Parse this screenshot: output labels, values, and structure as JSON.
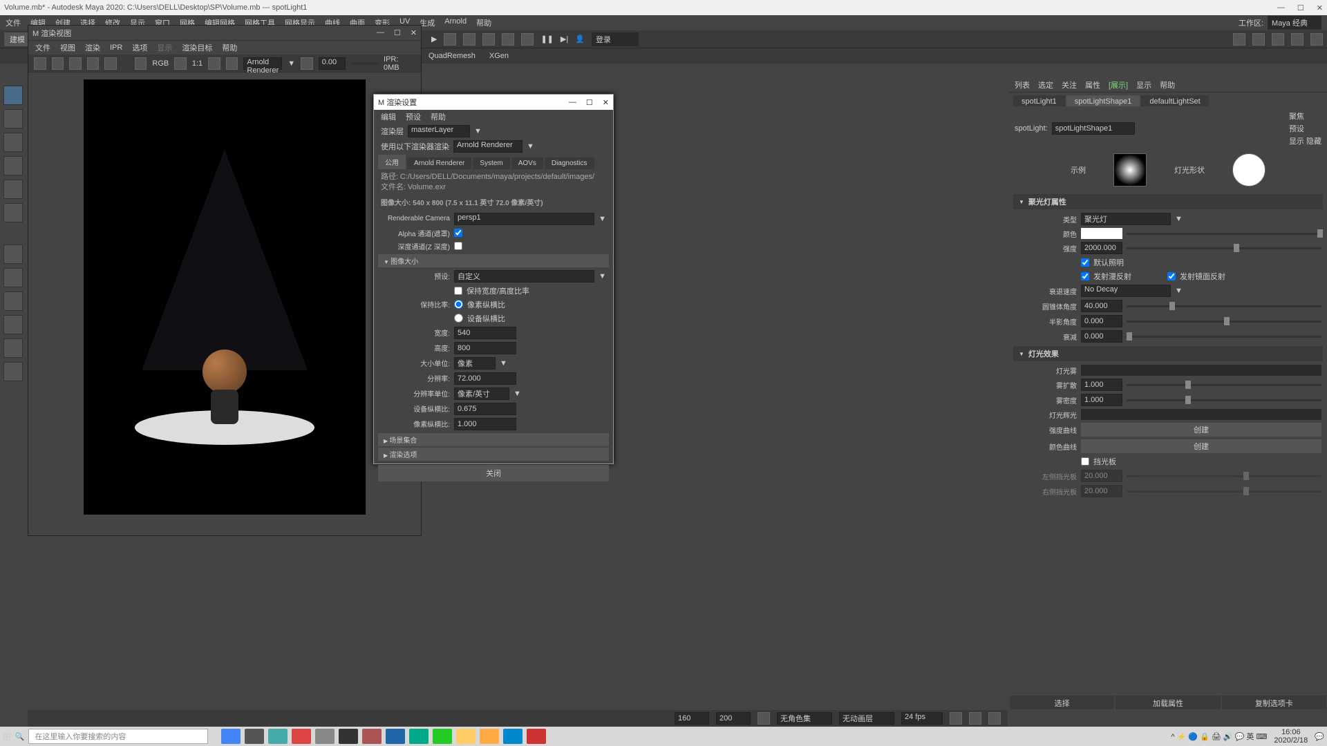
{
  "titlebar": "Volume.mb* - Autodesk Maya 2020: C:\\Users\\DELL\\Desktop\\SP\\Volume.mb  ---  spotLight1",
  "menus": [
    "文件",
    "编辑",
    "创建",
    "选择",
    "修改",
    "显示",
    "窗口",
    "网格",
    "编辑网格",
    "网格工具",
    "网格显示",
    "曲线",
    "曲面",
    "变形",
    "UV",
    "生成",
    "Arnold",
    "帮助"
  ],
  "workspace_label": "工作区:",
  "workspace_value": "Maya 经典",
  "shelf": {
    "mode": "建模",
    "login": "登录"
  },
  "tabs": [
    "QuadRemesh",
    "XGen"
  ],
  "rv": {
    "title": "渲染视图",
    "menus": [
      "文件",
      "视图",
      "渲染",
      "IPR",
      "选项",
      "显示",
      "渲染目标",
      "帮助"
    ],
    "renderer": "Arnold Renderer",
    "rgb": "RGB",
    "ratio": "1:1",
    "exposure": "0.00",
    "ipr": "IPR: 0MB"
  },
  "dlg": {
    "title": "渲染设置",
    "menus": [
      "编辑",
      "预设",
      "帮助"
    ],
    "layer_label": "渲染层",
    "layer_value": "masterLayer",
    "renderer_label": "使用以下渲染器渲染",
    "renderer_value": "Arnold Renderer",
    "tabs": [
      "公用",
      "Arnold Renderer",
      "System",
      "AOVs",
      "Diagnostics"
    ],
    "path_label": "路径:",
    "path_value": "C:/Users/DELL/Documents/maya/projects/default/images/",
    "file_label": "文件名:",
    "file_value": "Volume.exr",
    "size_info": "图像大小: 540 x 800 (7.5 x 11.1 英寸 72.0 像素/英寸)",
    "cam_label": "Renderable Camera",
    "cam_value": "persp1",
    "alpha_label": "Alpha 通道(遮罩)",
    "depth_label": "深度通道(Z 深度)",
    "section_imgsize": "图像大小",
    "preset_label": "预设:",
    "preset_value": "自定义",
    "keep_ratio": "保持宽度/高度比率",
    "keep_ratio2_label": "保持比率:",
    "keep_ratio2_opt1": "像素纵横比",
    "keep_ratio2_opt2": "设备纵横比",
    "width_label": "宽度:",
    "width_value": "540",
    "height_label": "高度:",
    "height_value": "800",
    "unit_label": "大小单位:",
    "unit_value": "像素",
    "res_label": "分辨率:",
    "res_value": "72.000",
    "resunit_label": "分辨率单位:",
    "resunit_value": "像素/英寸",
    "dev_label": "设备纵横比:",
    "dev_value": "0.675",
    "pix_label": "像素纵横比:",
    "pix_value": "1.000",
    "section_scene": "场景集合",
    "section_opts": "渲染选项",
    "close": "关闭"
  },
  "attr": {
    "tabs": [
      "列表",
      "选定",
      "关注",
      "属性",
      "展示",
      "显示",
      "帮助"
    ],
    "subtabs": [
      "spotLight1",
      "spotLightShape1",
      "defaultLightSet"
    ],
    "node_label": "spotLight:",
    "node_value": "spotLightShape1",
    "focus": "聚焦",
    "preset": "预设",
    "show": "显示",
    "hide": "隐藏",
    "sample_label": "示例",
    "light_shape_label": "灯光形状",
    "section_spot": "聚光灯属性",
    "type_label": "类型",
    "type_value": "聚光灯",
    "color_label": "颜色",
    "intensity_label": "强度",
    "intensity_value": "2000.000",
    "illum_default": "默认照明",
    "emit_diffuse": "发射漫反射",
    "emit_specular": "发射镜面反射",
    "decay_label": "衰退速度",
    "decay_value": "No Decay",
    "cone_label": "圆锥体角度",
    "cone_value": "40.000",
    "penumbra_label": "半影角度",
    "penumbra_value": "0.000",
    "dropoff_label": "衰减",
    "dropoff_value": "0.000",
    "section_fx": "灯光效果",
    "light_fog": "灯光雾",
    "fog_spread_label": "雾扩散",
    "fog_spread_value": "1.000",
    "fog_density_label": "雾密度",
    "fog_density_value": "1.000",
    "light_glow": "灯光辉光",
    "intensity_curve_label": "强度曲线",
    "create": "创建",
    "color_curve_label": "颜色曲线",
    "barn_doors": "挡光板",
    "left_barn_label": "左侧挡光板",
    "left_barn_value": "20.000",
    "right_barn_label": "右侧挡光板",
    "right_barn_value": "20.000",
    "btn_select": "选择",
    "btn_load": "加载属性",
    "btn_copy": "复制选项卡"
  },
  "timeline": {
    "r1": "160",
    "r2": "200",
    "anim1": "无角色集",
    "anim2": "无动画层",
    "fps": "24 fps"
  },
  "taskbar": {
    "search": "在这里输入你要搜索的内容",
    "time": "16:06",
    "date": "2020/2/18"
  }
}
